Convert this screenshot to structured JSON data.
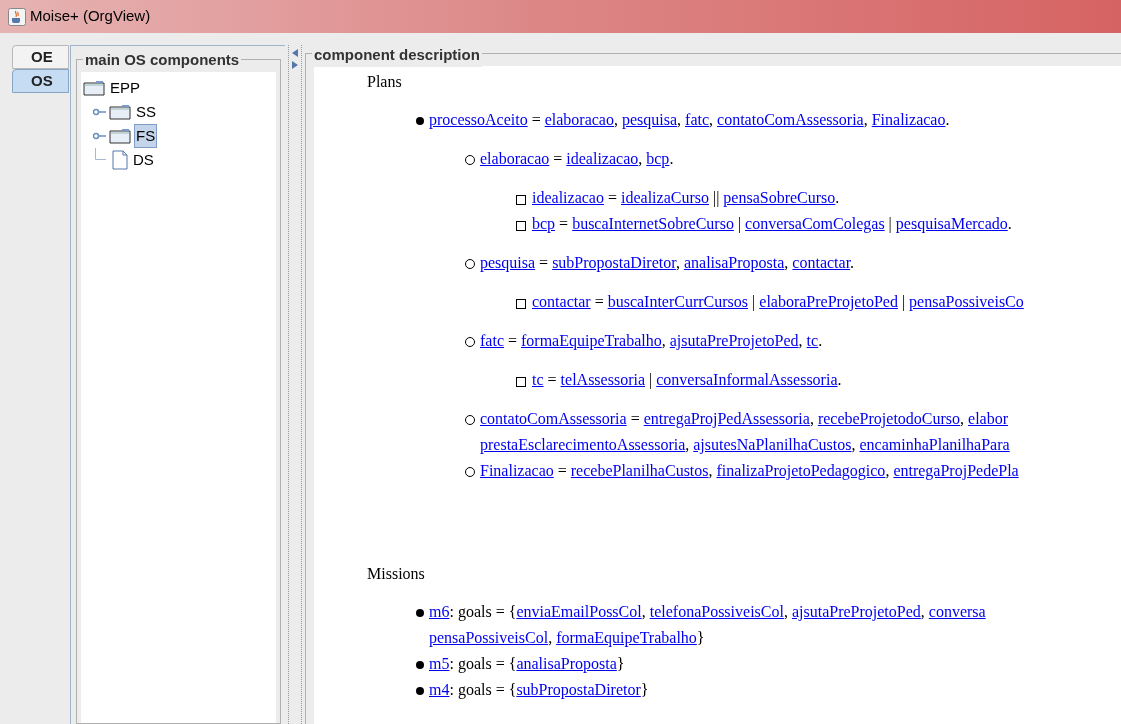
{
  "window": {
    "title": "Moise+ (OrgView)"
  },
  "tabs": [
    {
      "label": "OE",
      "selected": false
    },
    {
      "label": "OS",
      "selected": true
    }
  ],
  "components": {
    "title": "main OS components",
    "tree": [
      {
        "label": "EPP",
        "kind": "folder",
        "selected": false,
        "children": [
          {
            "label": "SS",
            "kind": "folder",
            "selected": false,
            "collapsed": true
          },
          {
            "label": "FS",
            "kind": "folder",
            "selected": true,
            "collapsed": true
          },
          {
            "label": "DS",
            "kind": "file",
            "selected": false,
            "collapsed": false
          }
        ]
      }
    ]
  },
  "description": {
    "title": "component description",
    "plans": {
      "heading": "Plans",
      "items": [
        {
          "lines": [
            [
              {
                "text": "processoAceito",
                "link": true
              },
              {
                "text": " = "
              },
              {
                "text": "elaboracao",
                "link": true
              },
              {
                "text": ", "
              },
              {
                "text": "pesquisa",
                "link": true
              },
              {
                "text": ", "
              },
              {
                "text": "fatc",
                "link": true
              },
              {
                "text": ", "
              },
              {
                "text": "contatoComAssessoria",
                "link": true
              },
              {
                "text": ", "
              },
              {
                "text": "Finalizacao",
                "link": true
              },
              {
                "text": "."
              }
            ]
          ],
          "children": [
            {
              "lines": [
                [
                  {
                    "text": "elaboracao",
                    "link": true
                  },
                  {
                    "text": " = "
                  },
                  {
                    "text": "idealizacao",
                    "link": true
                  },
                  {
                    "text": ", "
                  },
                  {
                    "text": "bcp",
                    "link": true
                  },
                  {
                    "text": "."
                  }
                ]
              ],
              "children": [
                {
                  "lines": [
                    [
                      {
                        "text": "idealizacao",
                        "link": true
                      },
                      {
                        "text": " = "
                      },
                      {
                        "text": "idealizaCurso",
                        "link": true
                      },
                      {
                        "text": " || "
                      },
                      {
                        "text": "pensaSobreCurso",
                        "link": true
                      },
                      {
                        "text": "."
                      }
                    ]
                  ]
                },
                {
                  "lines": [
                    [
                      {
                        "text": "bcp",
                        "link": true
                      },
                      {
                        "text": " = "
                      },
                      {
                        "text": "buscaInternetSobreCurso",
                        "link": true
                      },
                      {
                        "text": " | "
                      },
                      {
                        "text": "conversaComColegas",
                        "link": true
                      },
                      {
                        "text": " | "
                      },
                      {
                        "text": "pesquisaMercado",
                        "link": true
                      },
                      {
                        "text": "."
                      }
                    ]
                  ]
                }
              ]
            },
            {
              "lines": [
                [
                  {
                    "text": "pesquisa",
                    "link": true
                  },
                  {
                    "text": " = "
                  },
                  {
                    "text": "subPropostaDiretor",
                    "link": true
                  },
                  {
                    "text": ", "
                  },
                  {
                    "text": "analisaProposta",
                    "link": true
                  },
                  {
                    "text": ", "
                  },
                  {
                    "text": "contactar",
                    "link": true
                  },
                  {
                    "text": "."
                  }
                ]
              ],
              "children": [
                {
                  "lines": [
                    [
                      {
                        "text": "contactar",
                        "link": true
                      },
                      {
                        "text": " = "
                      },
                      {
                        "text": "buscaInterCurrCursos",
                        "link": true
                      },
                      {
                        "text": " | "
                      },
                      {
                        "text": "elaboraPreProjetoPed",
                        "link": true
                      },
                      {
                        "text": " | "
                      },
                      {
                        "text": "pensaPossiveisCo",
                        "link": true
                      }
                    ]
                  ]
                }
              ]
            },
            {
              "lines": [
                [
                  {
                    "text": "fatc",
                    "link": true
                  },
                  {
                    "text": " = "
                  },
                  {
                    "text": "formaEquipeTrabalho",
                    "link": true
                  },
                  {
                    "text": ", "
                  },
                  {
                    "text": "ajsutaPreProjetoPed",
                    "link": true
                  },
                  {
                    "text": ", "
                  },
                  {
                    "text": "tc",
                    "link": true
                  },
                  {
                    "text": "."
                  }
                ]
              ],
              "children": [
                {
                  "lines": [
                    [
                      {
                        "text": "tc",
                        "link": true
                      },
                      {
                        "text": " = "
                      },
                      {
                        "text": "telAssessoria",
                        "link": true
                      },
                      {
                        "text": " | "
                      },
                      {
                        "text": "conversaInformalAssessoria",
                        "link": true
                      },
                      {
                        "text": "."
                      }
                    ]
                  ]
                }
              ]
            },
            {
              "lines": [
                [
                  {
                    "text": "contatoComAssessoria",
                    "link": true
                  },
                  {
                    "text": " = "
                  },
                  {
                    "text": "entregaProjPedAssessoria",
                    "link": true
                  },
                  {
                    "text": ", "
                  },
                  {
                    "text": "recebeProjetodoCurso",
                    "link": true
                  },
                  {
                    "text": ", "
                  },
                  {
                    "text": "elabor",
                    "link": true
                  }
                ],
                [
                  {
                    "text": "prestaEsclarecimentoAssessoria",
                    "link": true
                  },
                  {
                    "text": ", "
                  },
                  {
                    "text": "ajsutesNaPlanilhaCustos",
                    "link": true
                  },
                  {
                    "text": ", "
                  },
                  {
                    "text": "encaminhaPlanilhaPara",
                    "link": true
                  }
                ]
              ]
            },
            {
              "lines": [
                [
                  {
                    "text": "Finalizacao",
                    "link": true
                  },
                  {
                    "text": " = "
                  },
                  {
                    "text": "recebePlanilhaCustos",
                    "link": true
                  },
                  {
                    "text": ", "
                  },
                  {
                    "text": "finalizaProjetoPedagogico",
                    "link": true
                  },
                  {
                    "text": ", "
                  },
                  {
                    "text": "entregaProjPedePla",
                    "link": true
                  }
                ]
              ]
            }
          ]
        }
      ]
    },
    "missions": {
      "heading": "Missions",
      "items": [
        {
          "lines": [
            [
              {
                "text": "m6",
                "link": true
              },
              {
                "text": ": goals = {"
              },
              {
                "text": "enviaEmailPossCol",
                "link": true
              },
              {
                "text": ", "
              },
              {
                "text": "telefonaPossiveisCol",
                "link": true
              },
              {
                "text": ", "
              },
              {
                "text": "ajsutaPreProjetoPed",
                "link": true
              },
              {
                "text": ", "
              },
              {
                "text": "conversa",
                "link": true
              }
            ],
            [
              {
                "text": "pensaPossiveisCol",
                "link": true
              },
              {
                "text": ", "
              },
              {
                "text": "formaEquipeTrabalho",
                "link": true
              },
              {
                "text": "}"
              }
            ]
          ]
        },
        {
          "lines": [
            [
              {
                "text": "m5",
                "link": true
              },
              {
                "text": ": goals = {"
              },
              {
                "text": "analisaProposta",
                "link": true
              },
              {
                "text": "}"
              }
            ]
          ]
        },
        {
          "lines": [
            [
              {
                "text": "m4",
                "link": true
              },
              {
                "text": ": goals = {"
              },
              {
                "text": "subPropostaDiretor",
                "link": true
              },
              {
                "text": "}"
              }
            ]
          ]
        }
      ]
    }
  }
}
